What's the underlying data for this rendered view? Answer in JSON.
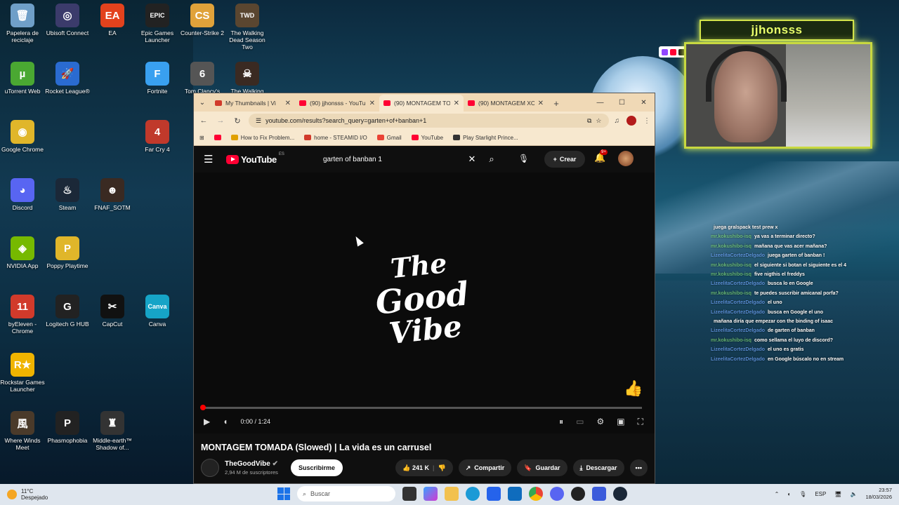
{
  "desktop": {
    "icons": [
      {
        "label": "Papelera de reciclaje",
        "glyph": "🗑",
        "color": "#6f9fc8",
        "col": 0,
        "row": 0
      },
      {
        "label": "Ubisoft Connect",
        "glyph": "◎",
        "color": "#3b3b6b",
        "col": 1,
        "row": 0
      },
      {
        "label": "EA",
        "glyph": "EA",
        "color": "#e3421d",
        "col": 2,
        "row": 0
      },
      {
        "label": "Epic Games Launcher",
        "glyph": "EPIC",
        "color": "#222",
        "col": 3,
        "row": 0
      },
      {
        "label": "Counter-Strike 2",
        "glyph": "CS",
        "color": "#e0a23a",
        "col": 4,
        "row": 0
      },
      {
        "label": "The Walking Dead Season Two",
        "glyph": "TWD",
        "color": "#5a4630",
        "col": 5,
        "row": 0
      },
      {
        "label": "uTorrent Web",
        "glyph": "µ",
        "color": "#4aa832",
        "col": 0,
        "row": 1
      },
      {
        "label": "Rocket League®",
        "glyph": "🚀",
        "color": "#2a6bd1",
        "col": 1,
        "row": 1
      },
      {
        "label": "Fortnite",
        "glyph": "F",
        "color": "#39a0f0",
        "col": 3,
        "row": 1
      },
      {
        "label": "Tom Clancy's",
        "glyph": "6",
        "color": "#555",
        "col": 4,
        "row": 1
      },
      {
        "label": "The Walking",
        "glyph": "☠",
        "color": "#3a2a22",
        "col": 5,
        "row": 1
      },
      {
        "label": "Google Chrome",
        "glyph": "◉",
        "color": "#e0b62a",
        "col": 0,
        "row": 2
      },
      {
        "label": "Far Cry 4",
        "glyph": "4",
        "color": "#c0392b",
        "col": 3,
        "row": 2
      },
      {
        "label": "Discord",
        "glyph": "◕",
        "color": "#5865f2",
        "col": 0,
        "row": 3
      },
      {
        "label": "Steam",
        "glyph": "♨",
        "color": "#1b2838",
        "col": 1,
        "row": 3
      },
      {
        "label": "FNAF_SOTM",
        "glyph": "☻",
        "color": "#3a2a22",
        "col": 2,
        "row": 3
      },
      {
        "label": "NVIDIA App",
        "glyph": "◈",
        "color": "#76b900",
        "col": 0,
        "row": 4
      },
      {
        "label": "Poppy Playtime",
        "glyph": "P",
        "color": "#e0b62a",
        "col": 1,
        "row": 4
      },
      {
        "label": "byEleven - Chrome",
        "glyph": "11",
        "color": "#d13a2b",
        "col": 0,
        "row": 5
      },
      {
        "label": "Logitech G HUB",
        "glyph": "G",
        "color": "#222",
        "col": 1,
        "row": 5
      },
      {
        "label": "CapCut",
        "glyph": "✂",
        "color": "#111",
        "col": 2,
        "row": 5
      },
      {
        "label": "Canva",
        "glyph": "Canva",
        "color": "#16a4c7",
        "col": 3,
        "row": 5
      },
      {
        "label": "Rockstar Games Launcher",
        "glyph": "R★",
        "color": "#f0b400",
        "col": 0,
        "row": 6
      },
      {
        "label": "Where Winds Meet",
        "glyph": "風",
        "color": "#4a3a2a",
        "col": 0,
        "row": 7
      },
      {
        "label": "Phasmophobia",
        "glyph": "P",
        "color": "#222",
        "col": 1,
        "row": 7
      },
      {
        "label": "Middle-earth™ Shadow of...",
        "glyph": "♜",
        "color": "#333",
        "col": 2,
        "row": 7
      }
    ]
  },
  "stream_overlay": {
    "streamer_name": "jjhonsss",
    "chat": [
      {
        "user": "",
        "msg": "juega gralspack test prew x",
        "color": "#7fdc7f"
      },
      {
        "user": "mr.kokushibo-isq",
        "msg": "ya vas a terminar directo?",
        "color": "#7fdc7f"
      },
      {
        "user": "mr.kokushibo-isq",
        "msg": "mañana que vas acer mañana?",
        "color": "#7fdc7f"
      },
      {
        "user": "LizeelitaCortezDelgado",
        "msg": "juega garten of banban !",
        "color": "#6fa8ff"
      },
      {
        "user": "mr.kokushibo-isq",
        "msg": "el siguiente si botan el siguiente es el 4",
        "color": "#7fdc7f"
      },
      {
        "user": "mr.kokushibo-isq",
        "msg": "five nigthis el freddys",
        "color": "#7fdc7f"
      },
      {
        "user": "LizeelitaCortezDelgado",
        "msg": "busca lo en Google",
        "color": "#6fa8ff"
      },
      {
        "user": "mr.kokushibo-isq",
        "msg": "te puedes suscribir amicanal porfa?",
        "color": "#7fdc7f"
      },
      {
        "user": "LizeelitaCortezDelgado",
        "msg": "el uno",
        "color": "#6fa8ff"
      },
      {
        "user": "LizeelitaCortezDelgado",
        "msg": "busca en Google el uno",
        "color": "#6fa8ff"
      },
      {
        "user": "",
        "msg": "mañana diría que empezar con the binding of isaac",
        "color": "#c88cff"
      },
      {
        "user": "LizeelitaCortezDelgado",
        "msg": "de garten of banban",
        "color": "#6fa8ff"
      },
      {
        "user": "mr.kokushibo-isq",
        "msg": "como sellama el luyo de discord?",
        "color": "#7fdc7f"
      },
      {
        "user": "LizeelitaCortezDelgado",
        "msg": "el uno es gratis",
        "color": "#6fa8ff"
      },
      {
        "user": "LizeelitaCortezDelgado",
        "msg": "en Google búscalo no en stream",
        "color": "#6fa8ff"
      }
    ]
  },
  "browser": {
    "tabs": [
      {
        "title": "My Thumbnails | Vi",
        "active": false,
        "fav_color": "#d13a2b"
      },
      {
        "title": "(90) jjhonsss - YouTu",
        "active": false,
        "fav_color": "#ff0033"
      },
      {
        "title": "(90) MONTAGEM TO",
        "active": true,
        "fav_color": "#ff0033"
      },
      {
        "title": "(90) MONTAGEM XC",
        "active": false,
        "fav_color": "#ff0033"
      }
    ],
    "url": "youtube.com/results?search_query=garten+of+banban+1",
    "bookmarks": [
      {
        "label": "",
        "color": "#ff0033"
      },
      {
        "label": "How to Fix Problem...",
        "color": "#e0a000"
      },
      {
        "label": "home - STEAMID I/O",
        "color": "#d13a2b"
      },
      {
        "label": "Gmail",
        "color": "#ea4335"
      },
      {
        "label": "YouTube",
        "color": "#ff0033"
      },
      {
        "label": "Play Starlight Prince...",
        "color": "#333"
      }
    ]
  },
  "youtube": {
    "brand": "YouTube",
    "region": "ES",
    "search_query": "garten of banban 1",
    "create_label": "Crear",
    "notif_count": "9+",
    "logo_lines": [
      "The",
      "Good",
      "Vibe"
    ],
    "time": "0:00 / 1:24",
    "progress": 0,
    "video_title": "MONTAGEM TOMADA (Slowed) | La vida es un carrusel",
    "channel_name": "TheGoodVibe",
    "subscribers": "2,94 M de suscriptores",
    "subscribe_label": "Suscribirme",
    "likes": "241 K",
    "share_label": "Compartir",
    "save_label": "Guardar",
    "download_label": "Descargar"
  },
  "taskbar": {
    "temperature": "11°C",
    "weather_desc": "Despejado",
    "search_placeholder": "Buscar",
    "language": "ESP",
    "time": "23:57",
    "date": "18/03/2026"
  }
}
